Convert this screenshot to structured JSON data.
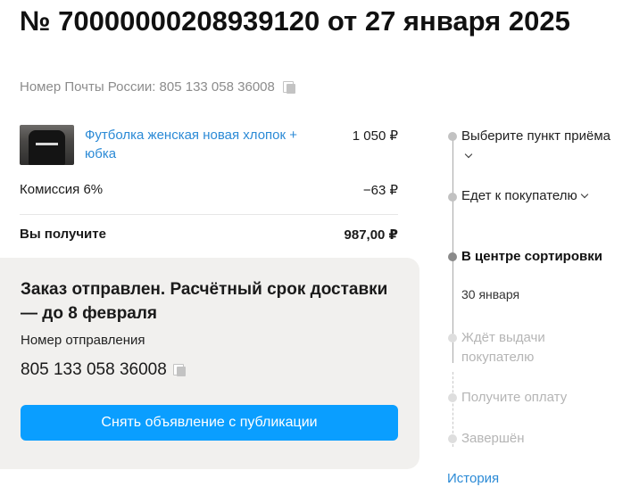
{
  "order": {
    "title": "№ 70000000208939120 от 27 января 2025",
    "post_number_label": "Номер Почты России: 805 133 058 36008"
  },
  "product": {
    "name": "Футболка женская новая хлопок + юбка",
    "price": "1 050 ₽"
  },
  "summary": {
    "commission_label": "Комиссия 6%",
    "commission_value": "−63 ₽",
    "total_label": "Вы получите",
    "total_value": "987,00 ₽"
  },
  "status_card": {
    "title": "Заказ отправлен. Расчётный срок доставки — до 8 февраля",
    "shipment_label": "Номер отправления",
    "shipment_number": "805 133 058 36008",
    "button_label": "Снять объявление с публикации"
  },
  "timeline": {
    "steps": [
      {
        "label": "Выберите пункт приёма",
        "state": "done",
        "expandable": true
      },
      {
        "label": "Едет к покупателю",
        "state": "done",
        "expandable": true
      },
      {
        "label": "В центре сортировки",
        "state": "current",
        "date": "30 января"
      },
      {
        "label": "Ждёт выдачи покупателю",
        "state": "future"
      },
      {
        "label": "Получите оплату",
        "state": "future"
      },
      {
        "label": "Завершён",
        "state": "future"
      }
    ],
    "history_link": "История"
  },
  "colors": {
    "accent": "#0a9eff",
    "link": "#2b8ad6",
    "card_bg": "#f1f0ee"
  }
}
